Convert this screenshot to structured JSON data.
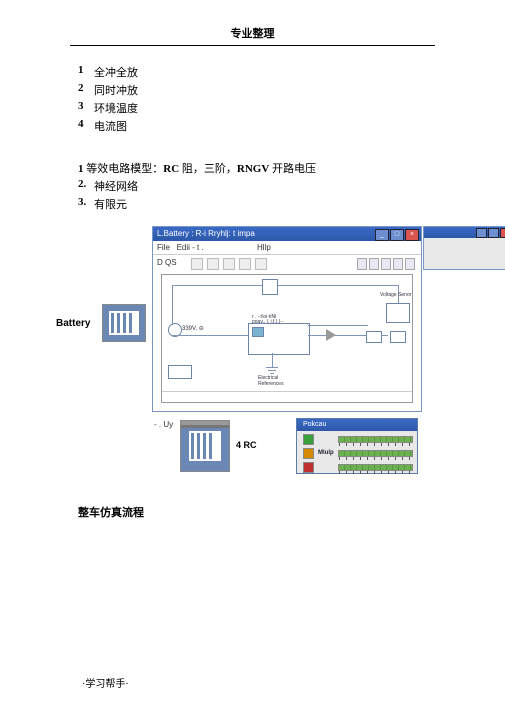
{
  "header": {
    "title": "专业整理"
  },
  "list1": {
    "items": [
      {
        "num": "1",
        "text": "全冲全放"
      },
      {
        "num": "2",
        "text": "同时冲放"
      },
      {
        "num": "3",
        "text": "环境温度"
      },
      {
        "num": "4",
        "text": "电流图"
      }
    ]
  },
  "list2": {
    "line1": {
      "num": "1",
      "pre": "等效电路模型：",
      "b1": "RC",
      "mid1": " 阻，三阶，",
      "b2": "RNGV",
      "mid2": " 开路电压"
    },
    "items": [
      {
        "num": "2.",
        "text": "神经网络"
      },
      {
        "num": "3.",
        "text": "有限元"
      }
    ]
  },
  "figure": {
    "battery_label": "Battery",
    "window_title": "L.Battery : R-i Rryhlj: t impa",
    "menu": {
      "file": "File",
      "edit": "Edii - t .",
      "help": "Hllp"
    },
    "toolbar_text": "D QS",
    "canvas": {
      "src_label": "339V. ⊖",
      "sub1": "r . -:i\\oi-tiNl",
      "sub2": "poav.. l. i.f.).|·-",
      "elec_ref": "Electrical\nReferences",
      "voltage": "Voltage Senor"
    },
    "bottom": {
      "left_text": "- . Uy",
      "rc_label": "4 RC"
    },
    "meter": {
      "title": "Pokcau",
      "rows": [
        {
          "label": "",
          "color": "#3aa03a"
        },
        {
          "label": "Mlulp",
          "color": "#d48a00"
        },
        {
          "label": "",
          "color": "#c03030"
        }
      ]
    }
  },
  "section": {
    "title": "整车仿真流程"
  },
  "footer": {
    "text": "·学习帮手·"
  }
}
